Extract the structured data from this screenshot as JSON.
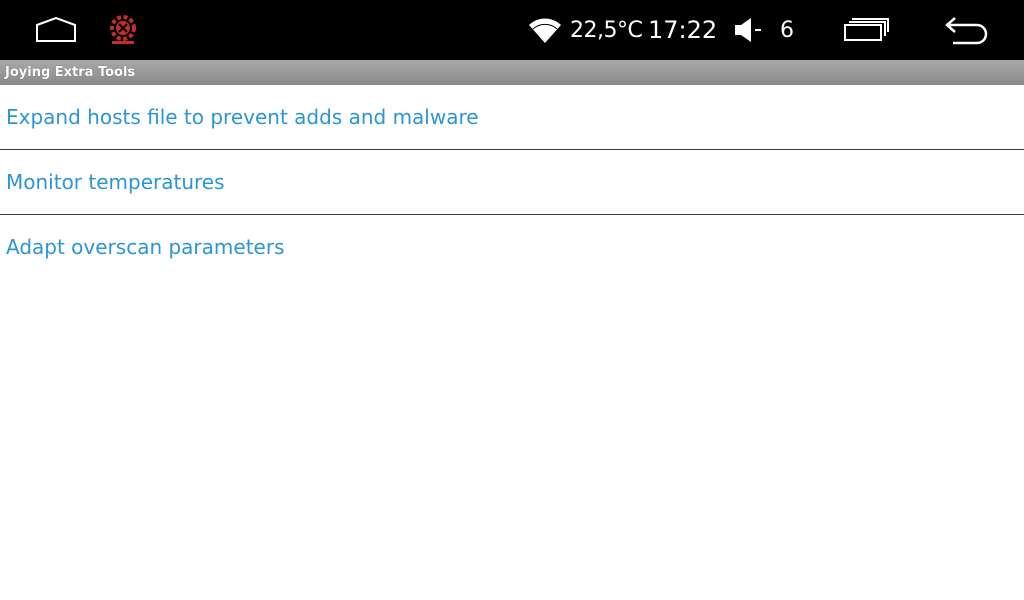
{
  "status_bar": {
    "temperature": "22,5°C",
    "clock": "17:22",
    "volume": "6",
    "icons": {
      "home": "home-icon",
      "app": "joying-logo-icon",
      "wifi": "wifi-icon",
      "volume": "volume-icon",
      "recents": "recent-apps-icon",
      "back": "back-icon"
    }
  },
  "app": {
    "title": "Joying Extra Tools"
  },
  "menu": {
    "items": [
      {
        "label": "Expand hosts file to prevent adds and malware"
      },
      {
        "label": "Monitor temperatures"
      },
      {
        "label": "Adapt overscan parameters"
      }
    ]
  },
  "colors": {
    "accent": "#2b95d6",
    "status_bar_bg": "#000000",
    "title_bar_bg": "#9a9a9a"
  }
}
